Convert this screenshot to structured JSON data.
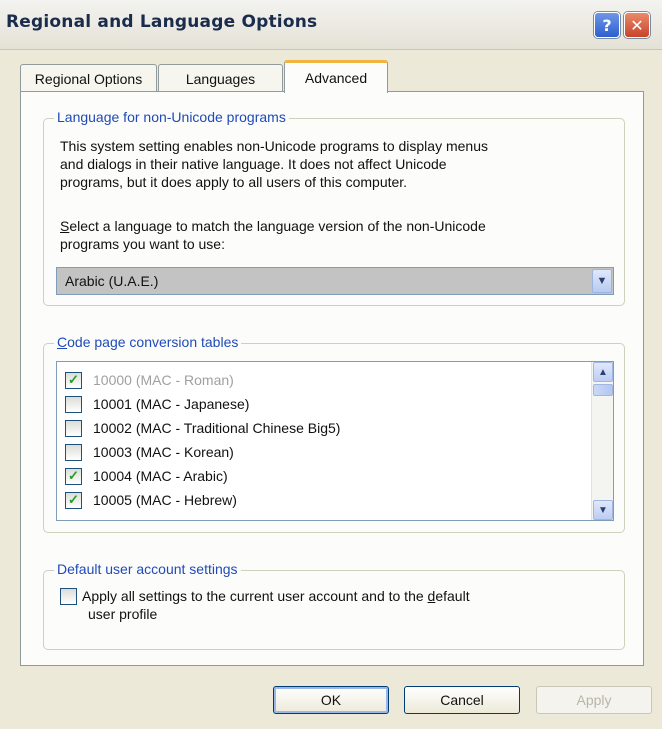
{
  "window": {
    "title": "Regional and Language Options",
    "help_label": "?",
    "close_label": "✕"
  },
  "tabs": [
    {
      "label": "Regional Options",
      "active": false
    },
    {
      "label": "Languages",
      "active": false
    },
    {
      "label": "Advanced",
      "active": true
    }
  ],
  "non_unicode": {
    "legend": "Language for non-Unicode programs",
    "description": [
      "This system setting enables non-Unicode programs to display menus",
      "and dialogs in their native language. It does not affect Unicode",
      "programs, but it does apply to all users of this computer."
    ],
    "select_prompt_accel": "S",
    "select_prompt_rest": "elect a language to match the language version of the non-Unicode",
    "select_prompt_line2": "programs you want to use:",
    "selected_language": "Arabic (U.A.E.)"
  },
  "code_pages": {
    "legend_accel": "C",
    "legend_rest": "ode page conversion tables",
    "items": [
      {
        "label": "10000 (MAC - Roman)",
        "checked": true,
        "disabled": true
      },
      {
        "label": "10001 (MAC - Japanese)",
        "checked": false,
        "disabled": false
      },
      {
        "label": "10002 (MAC - Traditional Chinese Big5)",
        "checked": false,
        "disabled": false
      },
      {
        "label": "10003 (MAC - Korean)",
        "checked": false,
        "disabled": false
      },
      {
        "label": "10004 (MAC - Arabic)",
        "checked": true,
        "disabled": false
      },
      {
        "label": "10005 (MAC - Hebrew)",
        "checked": true,
        "disabled": false
      }
    ]
  },
  "default_user": {
    "legend": "Default user account settings",
    "checkbox_line1_pre": "Apply all settings to the current user account and to the ",
    "checkbox_line1_accel": "d",
    "checkbox_line1_post": "efault",
    "checkbox_line2": "user profile",
    "checked": false
  },
  "buttons": {
    "ok": "OK",
    "cancel": "Cancel",
    "apply": "Apply"
  },
  "glyphs": {
    "check": "✓",
    "dropdown": "▼",
    "scroll_up": "▲",
    "scroll_down": "▼"
  },
  "colors": {
    "legend": "#1f4ab8",
    "check": "#21a121",
    "tab_highlight": "#f1b43f"
  }
}
